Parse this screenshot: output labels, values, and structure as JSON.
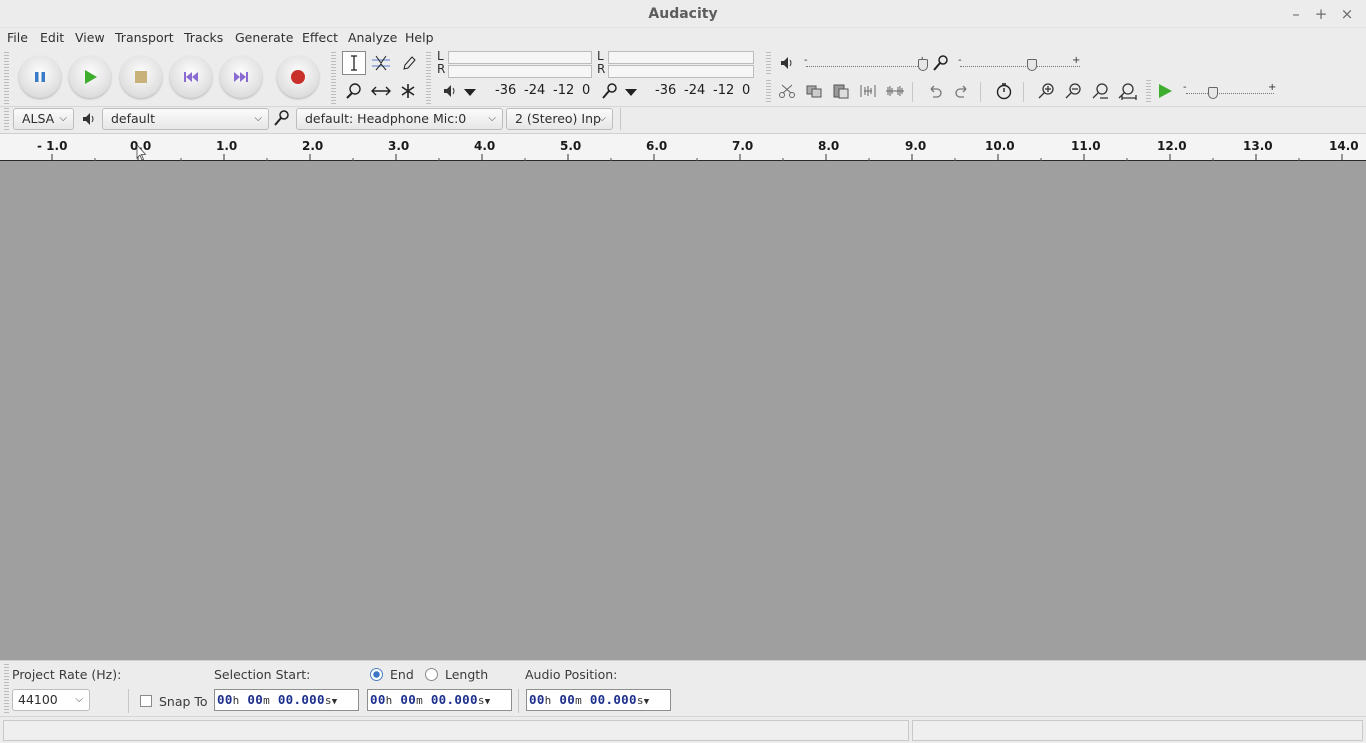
{
  "window": {
    "title": "Audacity",
    "minimize": "–",
    "maximize": "+",
    "close": "×"
  },
  "menu": [
    "File",
    "Edit",
    "View",
    "Transport",
    "Tracks",
    "Generate",
    "Effect",
    "Analyze",
    "Help"
  ],
  "meters": {
    "playback": {
      "left": "L",
      "right": "R",
      "scale": [
        "-36",
        "-24",
        "-12",
        "0"
      ]
    },
    "record": {
      "left": "L",
      "right": "R",
      "scale": [
        "-36",
        "-24",
        "-12",
        "0"
      ]
    }
  },
  "device": {
    "host": "ALSA",
    "playback_device": "default",
    "recording_device": "default: Headphone Mic:0",
    "channels": "2 (Stereo) Inp"
  },
  "ruler": {
    "ticks": [
      "- 1.0",
      "0.0",
      "1.0",
      "2.0",
      "3.0",
      "4.0",
      "5.0",
      "6.0",
      "7.0",
      "8.0",
      "9.0",
      "10.0",
      "11.0",
      "12.0",
      "13.0",
      "14.0"
    ]
  },
  "selection": {
    "project_rate_label": "Project Rate (Hz):",
    "project_rate": "44100",
    "snap_to": "Snap To",
    "selection_start_label": "Selection Start:",
    "end_label": "End",
    "length_label": "Length",
    "audio_position_label": "Audio Position:",
    "time_hh": "00",
    "time_mm": "00",
    "time_ss": "00.000",
    "unit_h": "h",
    "unit_m": "m",
    "unit_s": "s"
  },
  "colors": {
    "play_green": "#3fae2f",
    "record_red": "#c9302c",
    "transport_purple": "#8a6bd1",
    "track_bg": "#9f9f9f"
  }
}
